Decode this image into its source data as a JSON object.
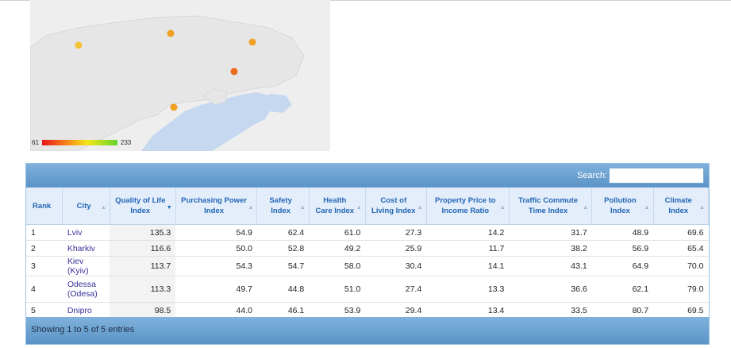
{
  "map": {
    "legend_min": "61",
    "legend_max": "233"
  },
  "search": {
    "label": "Search:",
    "value": ""
  },
  "table": {
    "headers": [
      "Rank",
      "City",
      "Quality of Life Index",
      "Purchasing Power Index",
      "Safety Index",
      "Health Care Index",
      "Cost of Living Index",
      "Property Price to Income Ratio",
      "Traffic Commute Time Index",
      "Pollution Index",
      "Climate Index"
    ],
    "rows": [
      [
        "1",
        "Lviv",
        "135.3",
        "54.9",
        "62.4",
        "61.0",
        "27.3",
        "14.2",
        "31.7",
        "48.9",
        "69.6"
      ],
      [
        "2",
        "Kharkiv",
        "116.6",
        "50.0",
        "52.8",
        "49.2",
        "25.9",
        "11.7",
        "38.2",
        "56.9",
        "65.4"
      ],
      [
        "3",
        "Kiev (Kyiv)",
        "113.7",
        "54.3",
        "54.7",
        "58.0",
        "30.4",
        "14.1",
        "43.1",
        "64.9",
        "70.0"
      ],
      [
        "4",
        "Odessa (Odesa)",
        "113.3",
        "49.7",
        "44.8",
        "51.0",
        "27.4",
        "13.3",
        "36.6",
        "62.1",
        "79.0"
      ],
      [
        "5",
        "Dnipro",
        "98.5",
        "44.0",
        "46.1",
        "53.9",
        "29.4",
        "13.4",
        "33.5",
        "80.7",
        "69.5"
      ]
    ]
  },
  "footer": {
    "info": "Showing 1 to 5 of 5 entries"
  }
}
